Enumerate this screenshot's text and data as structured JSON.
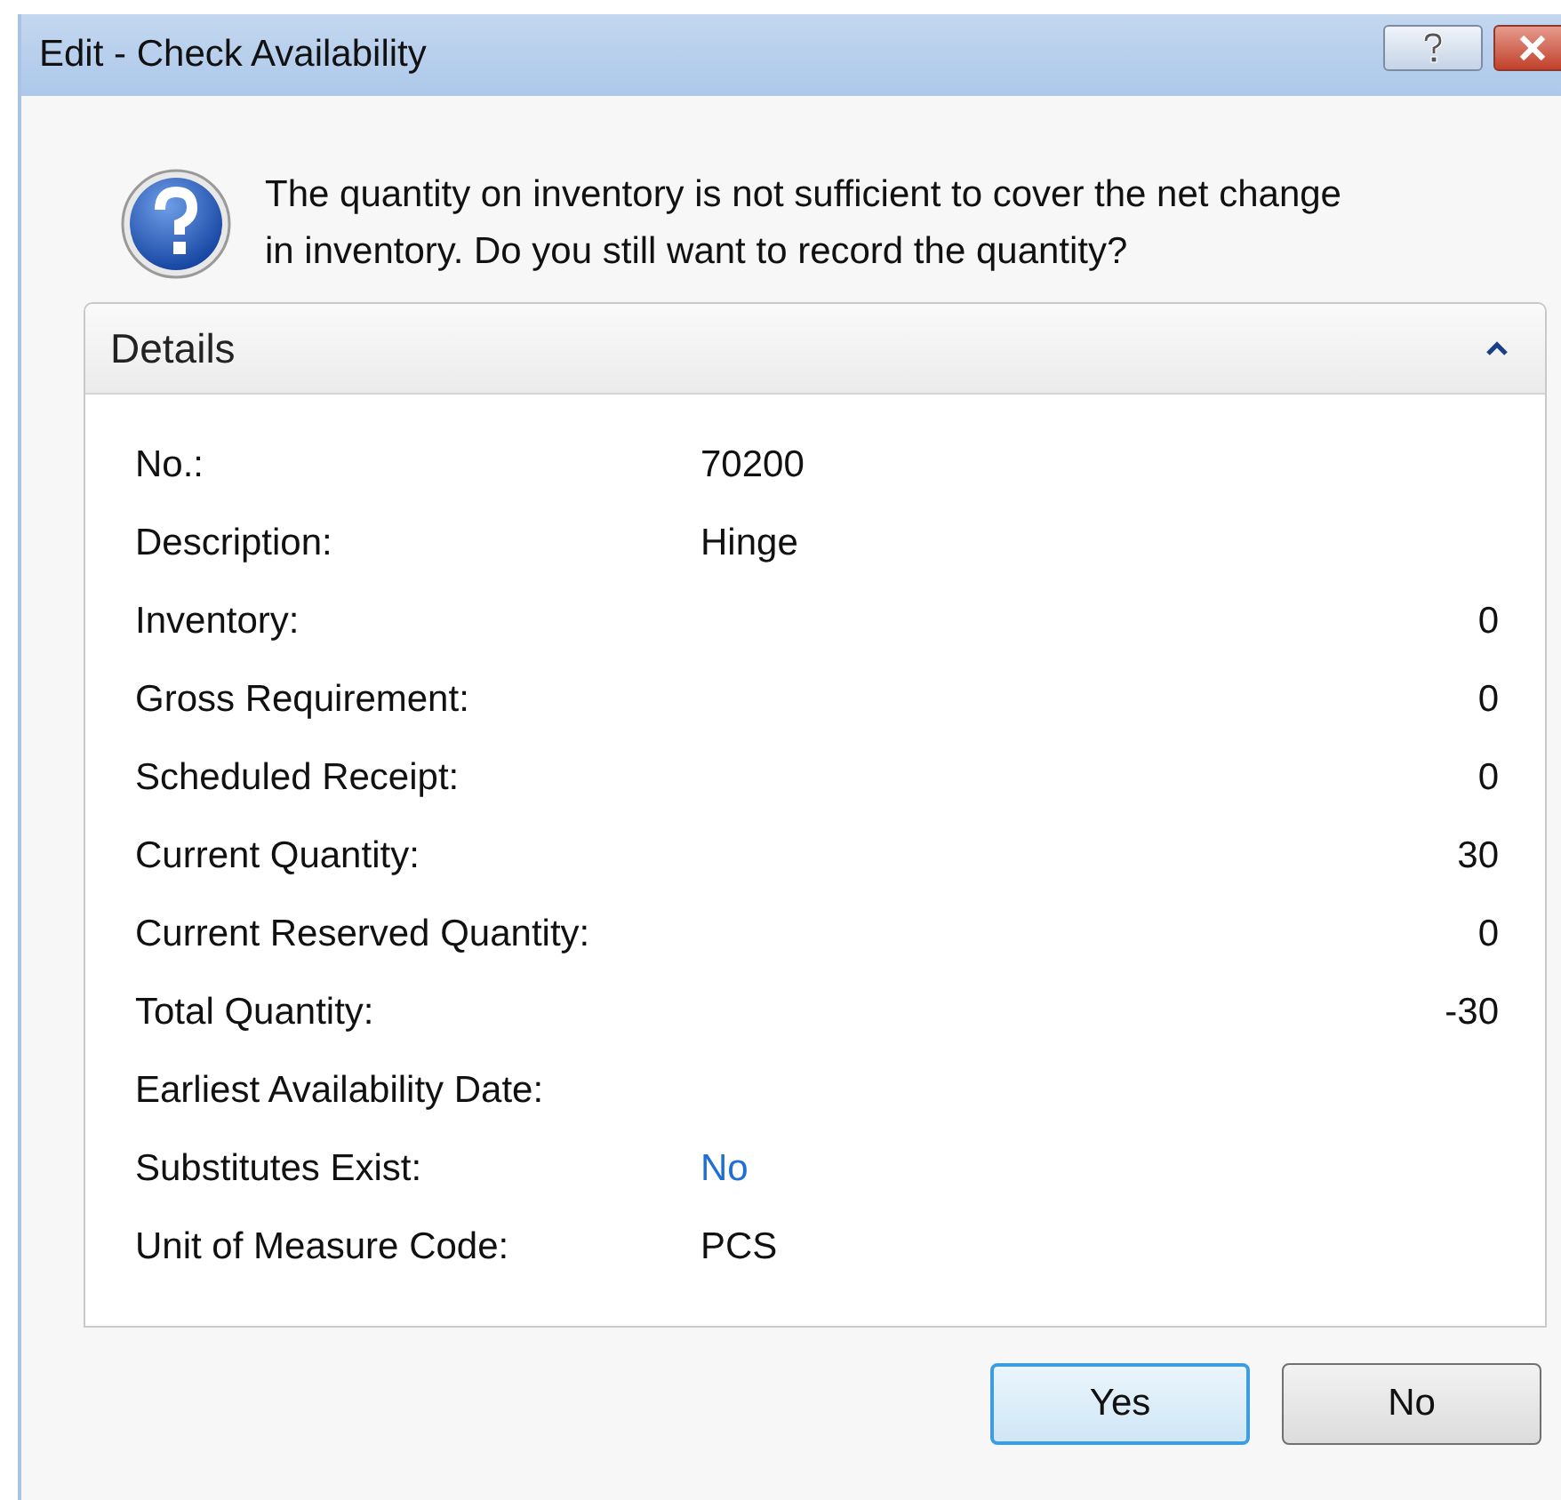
{
  "window": {
    "title": "Edit - Check Availability"
  },
  "message": "The quantity on inventory is not sufficient to cover the net change in inventory. Do you still want to record the quantity?",
  "details": {
    "title": "Details",
    "expanded": true,
    "fields": [
      {
        "label": "No.:",
        "value": "70200",
        "kind": "text"
      },
      {
        "label": "Description:",
        "value": "Hinge",
        "kind": "text"
      },
      {
        "label": "Inventory:",
        "value": "0",
        "kind": "number"
      },
      {
        "label": "Gross Requirement:",
        "value": "0",
        "kind": "number"
      },
      {
        "label": "Scheduled Receipt:",
        "value": "0",
        "kind": "number"
      },
      {
        "label": "Current Quantity:",
        "value": "30",
        "kind": "number"
      },
      {
        "label": "Current Reserved Quantity:",
        "value": "0",
        "kind": "number"
      },
      {
        "label": "Total Quantity:",
        "value": "-30",
        "kind": "number"
      },
      {
        "label": "Earliest Availability Date:"
      },
      {
        "label": "Substitutes Exist:",
        "value": "No",
        "kind": "link"
      },
      {
        "label": "Unit of Measure Code:",
        "value": "PCS",
        "kind": "text"
      }
    ]
  },
  "buttons": [
    {
      "label": "Yes",
      "default": true
    },
    {
      "label": "No",
      "default": false
    }
  ]
}
